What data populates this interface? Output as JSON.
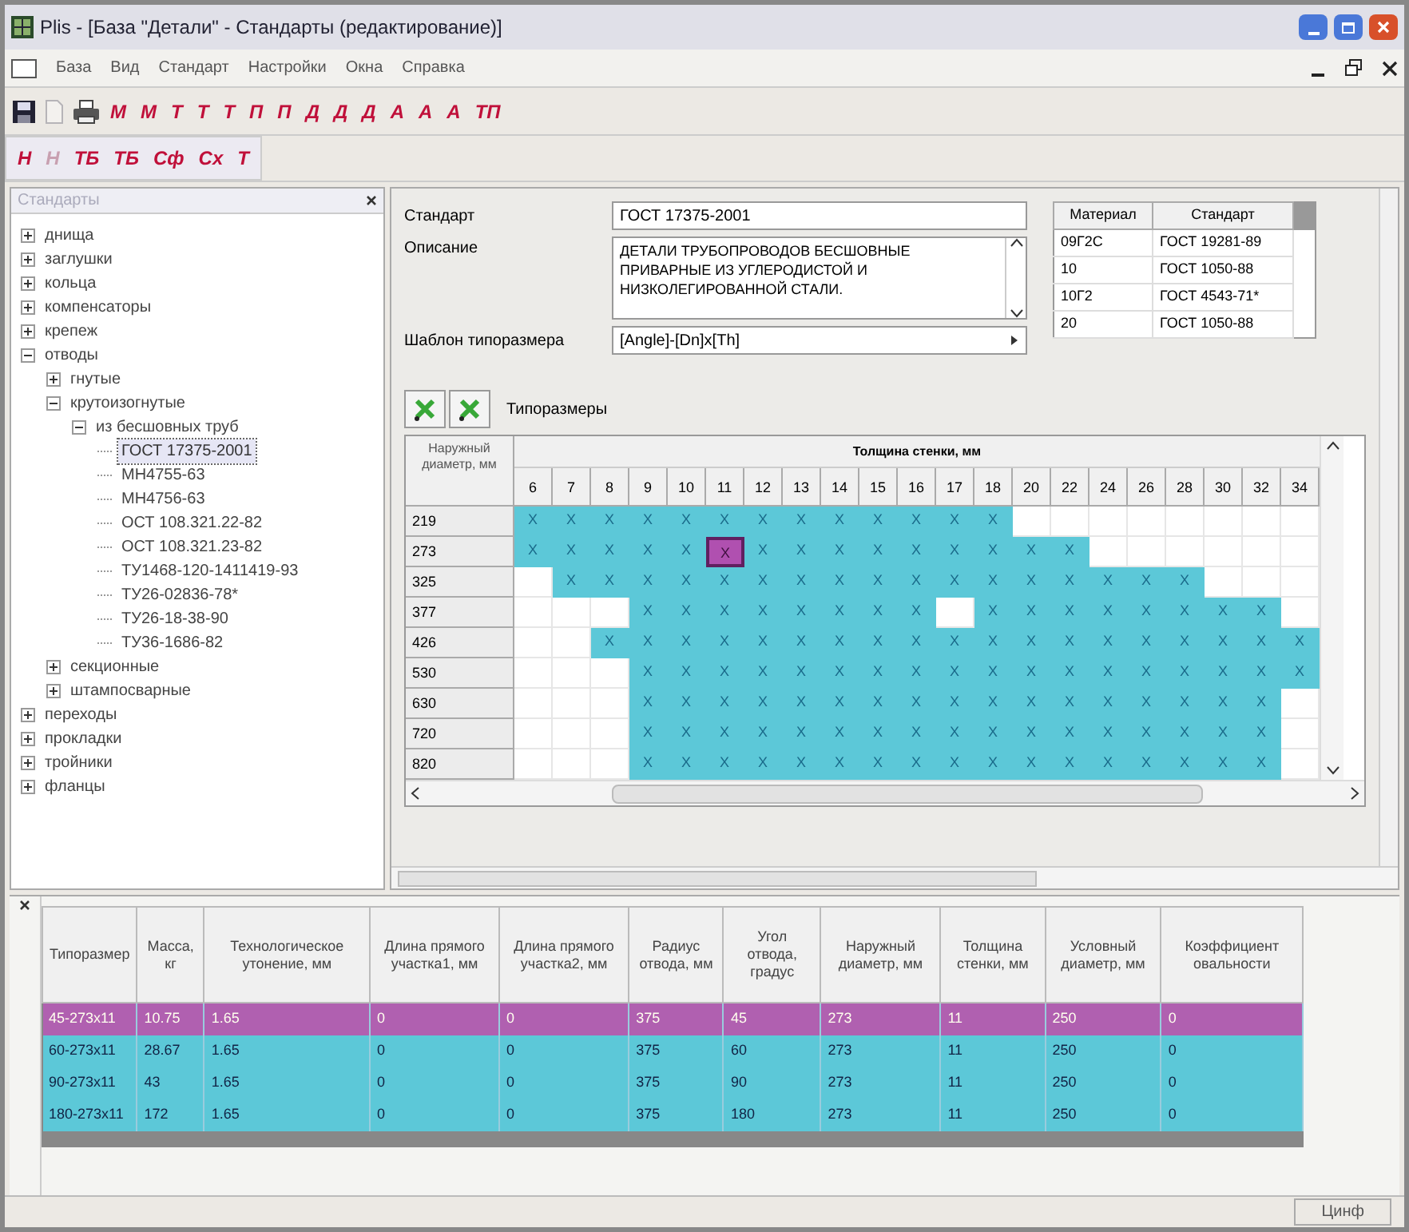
{
  "window": {
    "title": "Plis - [База \"Детали\" - Стандарты (редактирование)]"
  },
  "menu": [
    {
      "label": "База"
    },
    {
      "label": "Вид"
    },
    {
      "label": "Стандарт"
    },
    {
      "label": "Настройки"
    },
    {
      "label": "Окна"
    },
    {
      "label": "Справка"
    }
  ],
  "toolbar_1": [
    {
      "kind": "save",
      "disabled": false
    },
    {
      "kind": "new",
      "disabled": true
    },
    {
      "kind": "print",
      "disabled": false
    },
    {
      "kind": "text",
      "label": "М",
      "disabled": false
    },
    {
      "kind": "text",
      "label": "М",
      "disabled": false
    },
    {
      "kind": "text",
      "label": "Т",
      "disabled": false
    },
    {
      "kind": "text",
      "label": "Т",
      "disabled": false
    },
    {
      "kind": "text",
      "label": "Т",
      "disabled": false
    },
    {
      "kind": "text",
      "label": "П",
      "disabled": false
    },
    {
      "kind": "text",
      "label": "П",
      "disabled": false
    },
    {
      "kind": "text",
      "label": "Д",
      "disabled": false
    },
    {
      "kind": "text",
      "label": "Д",
      "disabled": false
    },
    {
      "kind": "text",
      "label": "Д",
      "disabled": false
    },
    {
      "kind": "text",
      "label": "А",
      "disabled": false
    },
    {
      "kind": "text",
      "label": "А",
      "disabled": false
    },
    {
      "kind": "text",
      "label": "А",
      "disabled": false
    },
    {
      "kind": "text",
      "label": "ТП",
      "disabled": false
    }
  ],
  "toolbar_2": [
    {
      "kind": "text",
      "label": "Н",
      "disabled": false
    },
    {
      "kind": "text",
      "label": "Н",
      "disabled": true
    },
    {
      "kind": "text",
      "label": "ТБ",
      "disabled": false
    },
    {
      "kind": "text",
      "label": "ТБ",
      "disabled": false
    },
    {
      "kind": "text",
      "label": "Сф",
      "disabled": false
    },
    {
      "kind": "text",
      "label": "Сх",
      "disabled": false
    },
    {
      "kind": "text",
      "label": "Т",
      "disabled": false
    }
  ],
  "tree_panel": {
    "title": "Стандарты",
    "items": [
      {
        "label": "днища",
        "expanded": false,
        "selected": false
      },
      {
        "label": "заглушки",
        "expanded": false,
        "selected": false
      },
      {
        "label": "кольца",
        "expanded": false,
        "selected": false
      },
      {
        "label": "компенсаторы",
        "expanded": false,
        "selected": false
      },
      {
        "label": "крепеж",
        "expanded": false,
        "selected": false
      },
      {
        "label": "отводы",
        "expanded": true,
        "selected": false,
        "children": [
          {
            "label": "гнутые",
            "expanded": false,
            "selected": false
          },
          {
            "label": "крутоизогнутые",
            "expanded": true,
            "selected": false,
            "children": [
              {
                "label": "из бесшовных труб",
                "expanded": true,
                "selected": false,
                "children": [
                  {
                    "label": "ГОСТ 17375-2001",
                    "selected": true
                  },
                  {
                    "label": "МН4755-63",
                    "selected": false
                  },
                  {
                    "label": "МН4756-63",
                    "selected": false
                  },
                  {
                    "label": "ОСТ 108.321.22-82",
                    "selected": false
                  },
                  {
                    "label": "ОСТ 108.321.23-82",
                    "selected": false
                  },
                  {
                    "label": "ТУ1468-120-1411419-93",
                    "selected": false
                  },
                  {
                    "label": "ТУ26-02836-78*",
                    "selected": false
                  },
                  {
                    "label": "ТУ26-18-38-90",
                    "selected": false
                  },
                  {
                    "label": "ТУ36-1686-82",
                    "selected": false
                  }
                ]
              }
            ]
          },
          {
            "label": "секционные",
            "expanded": false,
            "selected": false
          },
          {
            "label": "штампосварные",
            "expanded": false,
            "selected": false
          }
        ]
      },
      {
        "label": "переходы",
        "expanded": false,
        "selected": false
      },
      {
        "label": "прокладки",
        "expanded": false,
        "selected": false
      },
      {
        "label": "тройники",
        "expanded": false,
        "selected": false
      },
      {
        "label": "фланцы",
        "expanded": false,
        "selected": false
      }
    ]
  },
  "form": {
    "standard_label": "Стандарт",
    "standard": "ГОСТ 17375-2001",
    "description_label": "Описание",
    "description": "ДЕТАЛИ ТРУБОПРОВОДОВ БЕСШОВНЫЕ ПРИВАРНЫЕ ИЗ УГЛЕРОДИСТОЙ И НИЗКОЛЕГИРОВАННОЙ СТАЛИ.",
    "template_label": "Шаблон типоразмера",
    "template": "[Angle]-[Dn]x[Th]"
  },
  "materials": {
    "columns": [
      "Материал",
      "Стандарт"
    ],
    "rows": [
      [
        "09Г2С",
        "ГОСТ 19281-89"
      ],
      [
        "10",
        "ГОСТ 1050-88"
      ],
      [
        "10Г2",
        "ГОСТ 4543-71*"
      ],
      [
        "20",
        "ГОСТ 1050-88"
      ]
    ]
  },
  "sizes_label": "Типоразмеры",
  "size_grid": {
    "corner": "Наружный диаметр, мм",
    "header": "Толщина стенки, мм",
    "columns": [
      "6",
      "7",
      "8",
      "9",
      "10",
      "11",
      "12",
      "13",
      "14",
      "15",
      "16",
      "17",
      "18",
      "20",
      "22",
      "24",
      "26",
      "28",
      "30",
      "32",
      "34"
    ],
    "rows": [
      {
        "label": "219",
        "cells": [
          {
            "kind": "x",
            "text": "X"
          },
          {
            "kind": "x",
            "text": "X"
          },
          {
            "kind": "x",
            "text": "X"
          },
          {
            "kind": "x",
            "text": "X"
          },
          {
            "kind": "x",
            "text": "X"
          },
          {
            "kind": "x",
            "text": "X"
          },
          {
            "kind": "x",
            "text": "X"
          },
          {
            "kind": "x",
            "text": "X"
          },
          {
            "kind": "x",
            "text": "X"
          },
          {
            "kind": "x",
            "text": "X"
          },
          {
            "kind": "x",
            "text": "X"
          },
          {
            "kind": "x",
            "text": "X"
          },
          {
            "kind": "x",
            "text": "X"
          },
          {
            "kind": "empty"
          },
          {
            "kind": "empty"
          },
          {
            "kind": "empty"
          },
          {
            "kind": "empty"
          },
          {
            "kind": "empty"
          },
          {
            "kind": "empty"
          },
          {
            "kind": "empty"
          },
          {
            "kind": "empty"
          }
        ]
      },
      {
        "label": "273",
        "cells": [
          {
            "kind": "x",
            "text": "X"
          },
          {
            "kind": "x",
            "text": "X"
          },
          {
            "kind": "x",
            "text": "X"
          },
          {
            "kind": "x",
            "text": "X"
          },
          {
            "kind": "x",
            "text": "X"
          },
          {
            "kind": "current",
            "text": "X"
          },
          {
            "kind": "x",
            "text": "X"
          },
          {
            "kind": "x",
            "text": "X"
          },
          {
            "kind": "x",
            "text": "X"
          },
          {
            "kind": "x",
            "text": "X"
          },
          {
            "kind": "x",
            "text": "X"
          },
          {
            "kind": "x",
            "text": "X"
          },
          {
            "kind": "x",
            "text": "X"
          },
          {
            "kind": "x",
            "text": "X"
          },
          {
            "kind": "x",
            "text": "X"
          },
          {
            "kind": "empty"
          },
          {
            "kind": "empty"
          },
          {
            "kind": "empty"
          },
          {
            "kind": "empty"
          },
          {
            "kind": "empty"
          },
          {
            "kind": "empty"
          }
        ]
      },
      {
        "label": "325",
        "cells": [
          {
            "kind": "empty"
          },
          {
            "kind": "x",
            "text": "X"
          },
          {
            "kind": "x",
            "text": "X"
          },
          {
            "kind": "x",
            "text": "X"
          },
          {
            "kind": "x",
            "text": "X"
          },
          {
            "kind": "x",
            "text": "X"
          },
          {
            "kind": "x",
            "text": "X"
          },
          {
            "kind": "x",
            "text": "X"
          },
          {
            "kind": "x",
            "text": "X"
          },
          {
            "kind": "x",
            "text": "X"
          },
          {
            "kind": "x",
            "text": "X"
          },
          {
            "kind": "x",
            "text": "X"
          },
          {
            "kind": "x",
            "text": "X"
          },
          {
            "kind": "x",
            "text": "X"
          },
          {
            "kind": "x",
            "text": "X"
          },
          {
            "kind": "x",
            "text": "X"
          },
          {
            "kind": "x",
            "text": "X"
          },
          {
            "kind": "x",
            "text": "X"
          },
          {
            "kind": "empty"
          },
          {
            "kind": "empty"
          },
          {
            "kind": "empty"
          }
        ]
      },
      {
        "label": "377",
        "cells": [
          {
            "kind": "empty"
          },
          {
            "kind": "empty"
          },
          {
            "kind": "empty"
          },
          {
            "kind": "x",
            "text": "X"
          },
          {
            "kind": "x",
            "text": "X"
          },
          {
            "kind": "x",
            "text": "X"
          },
          {
            "kind": "x",
            "text": "X"
          },
          {
            "kind": "x",
            "text": "X"
          },
          {
            "kind": "x",
            "text": "X"
          },
          {
            "kind": "x",
            "text": "X"
          },
          {
            "kind": "x",
            "text": "X"
          },
          {
            "kind": "empty"
          },
          {
            "kind": "x",
            "text": "X"
          },
          {
            "kind": "x",
            "text": "X"
          },
          {
            "kind": "x",
            "text": "X"
          },
          {
            "kind": "x",
            "text": "X"
          },
          {
            "kind": "x",
            "text": "X"
          },
          {
            "kind": "x",
            "text": "X"
          },
          {
            "kind": "x",
            "text": "X"
          },
          {
            "kind": "x",
            "text": "X"
          },
          {
            "kind": "empty"
          }
        ]
      },
      {
        "label": "426",
        "cells": [
          {
            "kind": "empty"
          },
          {
            "kind": "empty"
          },
          {
            "kind": "x",
            "text": "X"
          },
          {
            "kind": "x",
            "text": "X"
          },
          {
            "kind": "x",
            "text": "X"
          },
          {
            "kind": "x",
            "text": "X"
          },
          {
            "kind": "x",
            "text": "X"
          },
          {
            "kind": "x",
            "text": "X"
          },
          {
            "kind": "x",
            "text": "X"
          },
          {
            "kind": "x",
            "text": "X"
          },
          {
            "kind": "x",
            "text": "X"
          },
          {
            "kind": "x",
            "text": "X"
          },
          {
            "kind": "x",
            "text": "X"
          },
          {
            "kind": "x",
            "text": "X"
          },
          {
            "kind": "x",
            "text": "X"
          },
          {
            "kind": "x",
            "text": "X"
          },
          {
            "kind": "x",
            "text": "X"
          },
          {
            "kind": "x",
            "text": "X"
          },
          {
            "kind": "x",
            "text": "X"
          },
          {
            "kind": "x",
            "text": "X"
          },
          {
            "kind": "x",
            "text": "X"
          }
        ]
      },
      {
        "label": "530",
        "cells": [
          {
            "kind": "empty"
          },
          {
            "kind": "empty"
          },
          {
            "kind": "empty"
          },
          {
            "kind": "x",
            "text": "X"
          },
          {
            "kind": "x",
            "text": "X"
          },
          {
            "kind": "x",
            "text": "X"
          },
          {
            "kind": "x",
            "text": "X"
          },
          {
            "kind": "x",
            "text": "X"
          },
          {
            "kind": "x",
            "text": "X"
          },
          {
            "kind": "x",
            "text": "X"
          },
          {
            "kind": "x",
            "text": "X"
          },
          {
            "kind": "x",
            "text": "X"
          },
          {
            "kind": "x",
            "text": "X"
          },
          {
            "kind": "x",
            "text": "X"
          },
          {
            "kind": "x",
            "text": "X"
          },
          {
            "kind": "x",
            "text": "X"
          },
          {
            "kind": "x",
            "text": "X"
          },
          {
            "kind": "x",
            "text": "X"
          },
          {
            "kind": "x",
            "text": "X"
          },
          {
            "kind": "x",
            "text": "X"
          },
          {
            "kind": "x",
            "text": "X"
          }
        ]
      },
      {
        "label": "630",
        "cells": [
          {
            "kind": "empty"
          },
          {
            "kind": "empty"
          },
          {
            "kind": "empty"
          },
          {
            "kind": "x",
            "text": "X"
          },
          {
            "kind": "x",
            "text": "X"
          },
          {
            "kind": "x",
            "text": "X"
          },
          {
            "kind": "x",
            "text": "X"
          },
          {
            "kind": "x",
            "text": "X"
          },
          {
            "kind": "x",
            "text": "X"
          },
          {
            "kind": "x",
            "text": "X"
          },
          {
            "kind": "x",
            "text": "X"
          },
          {
            "kind": "x",
            "text": "X"
          },
          {
            "kind": "x",
            "text": "X"
          },
          {
            "kind": "x",
            "text": "X"
          },
          {
            "kind": "x",
            "text": "X"
          },
          {
            "kind": "x",
            "text": "X"
          },
          {
            "kind": "x",
            "text": "X"
          },
          {
            "kind": "x",
            "text": "X"
          },
          {
            "kind": "x",
            "text": "X"
          },
          {
            "kind": "x",
            "text": "X"
          },
          {
            "kind": "empty"
          }
        ]
      },
      {
        "label": "720",
        "cells": [
          {
            "kind": "empty"
          },
          {
            "kind": "empty"
          },
          {
            "kind": "empty"
          },
          {
            "kind": "x",
            "text": "X"
          },
          {
            "kind": "x",
            "text": "X"
          },
          {
            "kind": "x",
            "text": "X"
          },
          {
            "kind": "x",
            "text": "X"
          },
          {
            "kind": "x",
            "text": "X"
          },
          {
            "kind": "x",
            "text": "X"
          },
          {
            "kind": "x",
            "text": "X"
          },
          {
            "kind": "x",
            "text": "X"
          },
          {
            "kind": "x",
            "text": "X"
          },
          {
            "kind": "x",
            "text": "X"
          },
          {
            "kind": "x",
            "text": "X"
          },
          {
            "kind": "x",
            "text": "X"
          },
          {
            "kind": "x",
            "text": "X"
          },
          {
            "kind": "x",
            "text": "X"
          },
          {
            "kind": "x",
            "text": "X"
          },
          {
            "kind": "x",
            "text": "X"
          },
          {
            "kind": "x",
            "text": "X"
          },
          {
            "kind": "empty"
          }
        ]
      },
      {
        "label": "820",
        "cells": [
          {
            "kind": "empty"
          },
          {
            "kind": "empty"
          },
          {
            "kind": "empty"
          },
          {
            "kind": "x",
            "text": "X"
          },
          {
            "kind": "x",
            "text": "X"
          },
          {
            "kind": "x",
            "text": "X"
          },
          {
            "kind": "x",
            "text": "X"
          },
          {
            "kind": "x",
            "text": "X"
          },
          {
            "kind": "x",
            "text": "X"
          },
          {
            "kind": "x",
            "text": "X"
          },
          {
            "kind": "x",
            "text": "X"
          },
          {
            "kind": "x",
            "text": "X"
          },
          {
            "kind": "x",
            "text": "X"
          },
          {
            "kind": "x",
            "text": "X"
          },
          {
            "kind": "x",
            "text": "X"
          },
          {
            "kind": "x",
            "text": "X"
          },
          {
            "kind": "x",
            "text": "X"
          },
          {
            "kind": "x",
            "text": "X"
          },
          {
            "kind": "x",
            "text": "X"
          },
          {
            "kind": "x",
            "text": "X"
          },
          {
            "kind": "empty"
          }
        ]
      }
    ]
  },
  "sizes_table": {
    "columns": [
      "Типоразмер",
      "Масса, кг",
      "Технологическое утонение, мм",
      "Длина прямого участка1, мм",
      "Длина прямого участка2, мм",
      "Радиус отвода, мм",
      "Угол отвода, градус",
      "Наружный диаметр, мм",
      "Толщина стенки, мм",
      "Условный диаметр, мм",
      "Коэффициент овальности"
    ],
    "rows": [
      {
        "selected": true,
        "cells": [
          "45-273x11",
          "10.75",
          "1.65",
          "0",
          "0",
          "375",
          "45",
          "273",
          "11",
          "250",
          "0"
        ]
      },
      {
        "selected": false,
        "cells": [
          "60-273x11",
          "28.67",
          "1.65",
          "0",
          "0",
          "375",
          "60",
          "273",
          "11",
          "250",
          "0"
        ]
      },
      {
        "selected": false,
        "cells": [
          "90-273x11",
          "43",
          "1.65",
          "0",
          "0",
          "375",
          "90",
          "273",
          "11",
          "250",
          "0"
        ]
      },
      {
        "selected": false,
        "cells": [
          "180-273x11",
          "172",
          "1.65",
          "0",
          "0",
          "375",
          "180",
          "273",
          "11",
          "250",
          "0"
        ]
      }
    ]
  },
  "status_bar": {
    "panel": "Цинф"
  }
}
